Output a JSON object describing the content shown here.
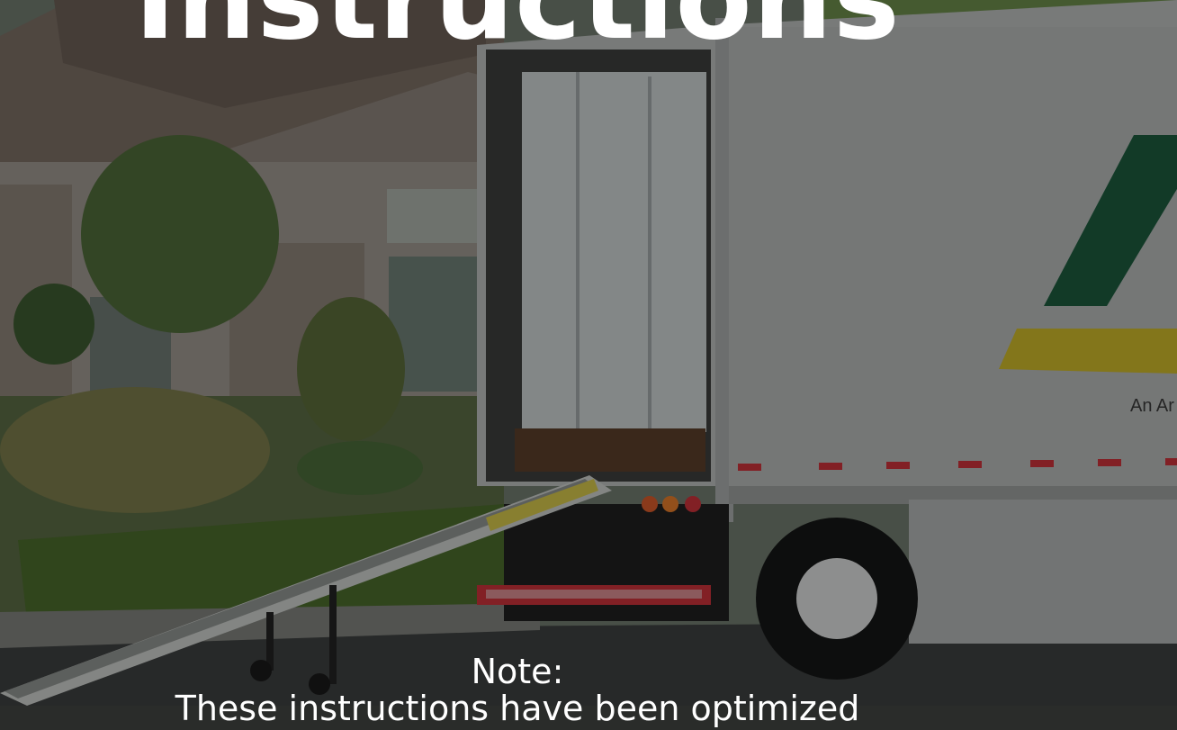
{
  "page": {
    "heading": "Instructions",
    "note_label": "Note:",
    "note_text": "These instructions have been optimized"
  },
  "truck": {
    "brand_caption": "An Ar"
  },
  "colors": {
    "brand_green": "#1c5a3c",
    "brand_yellow": "#c9b52a",
    "trailer_body": "#b9bcbb",
    "reflector_red": "#c8323a",
    "overlay_dim": "#000000"
  }
}
